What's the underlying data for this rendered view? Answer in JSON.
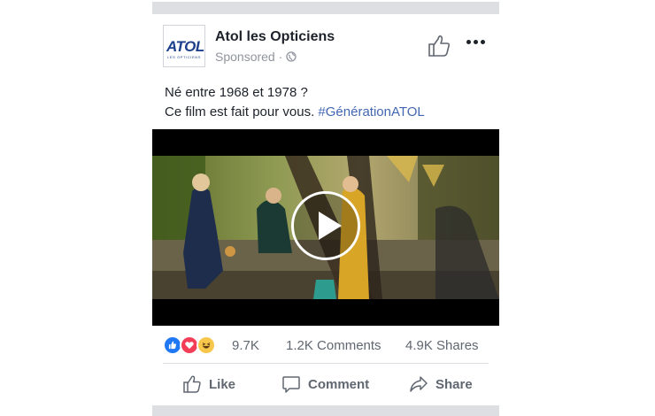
{
  "post": {
    "page_name": "Atol les Opticiens",
    "sponsored": "Sponsored ·",
    "logo_text": "ATOL",
    "logo_sub": "LES OPTICIENS",
    "text_line1": "Né entre 1968 et 1978 ?",
    "text_line2_prefix": "Ce film est fait pour vous. ",
    "hashtag": "#GénérationATOL"
  },
  "stats": {
    "reaction_count": "9.7K",
    "comments": "1.2K Comments",
    "shares": "4.9K Shares",
    "reactions": [
      "like-reaction-icon",
      "love-reaction-icon",
      "haha-reaction-icon"
    ]
  },
  "actions": {
    "like": "Like",
    "comment": "Comment",
    "share": "Share"
  },
  "colors": {
    "link": "#4267b2",
    "muted": "#606770",
    "like_blue": "#2078f4",
    "love_red": "#f33e58",
    "haha_yellow": "#f7c74b"
  }
}
